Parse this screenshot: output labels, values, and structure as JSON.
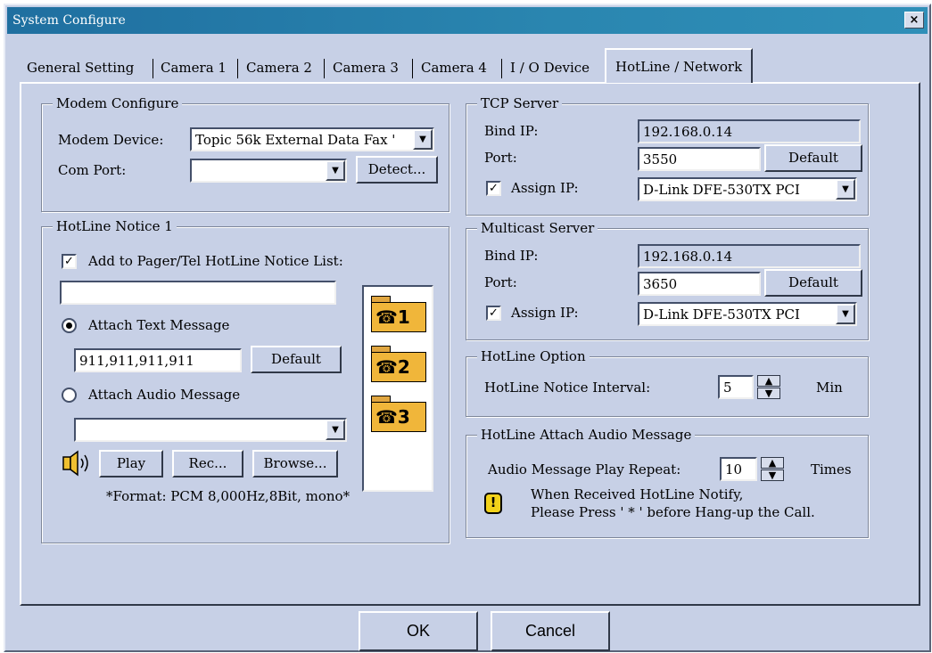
{
  "window": {
    "title": "System Configure",
    "close_glyph": "×"
  },
  "tabs": [
    {
      "label": "General Setting"
    },
    {
      "label": "Camera 1"
    },
    {
      "label": "Camera 2"
    },
    {
      "label": "Camera 3"
    },
    {
      "label": "Camera 4"
    },
    {
      "label": "I / O Device"
    },
    {
      "label": "HotLine / Network",
      "active": true
    }
  ],
  "modem": {
    "title": "Modem Configure",
    "device_label": "Modem Device:",
    "device_value": "Topic 56k External Data Fax '",
    "com_port_label": "Com Port:",
    "com_port_value": "",
    "detect_button": "Detect..."
  },
  "hotline_notice": {
    "title": "HotLine Notice 1",
    "add_checkbox_label": "Add to Pager/Tel HotLine Notice List:",
    "add_checked": true,
    "number_value": "",
    "attach_text_label": "Attach Text Message",
    "attach_text_selected": true,
    "text_message_value": "911,911,911,911",
    "default_button": "Default",
    "attach_audio_label": "Attach Audio Message",
    "audio_value": "",
    "play_button": "Play",
    "rec_button": "Rec...",
    "browse_button": "Browse...",
    "format_note": "*Format: PCM 8,000Hz,8Bit, mono*",
    "hotlines": [
      {
        "label": "1"
      },
      {
        "label": "2"
      },
      {
        "label": "3"
      }
    ]
  },
  "tcp_server": {
    "title": "TCP Server",
    "bind_ip_label": "Bind IP:",
    "bind_ip_value": "192.168.0.14",
    "port_label": "Port:",
    "port_value": "3550",
    "default_button": "Default",
    "assign_ip_label": "Assign IP:",
    "assign_checked": true,
    "adapter_value": "D-Link DFE-530TX PCI"
  },
  "multicast_server": {
    "title": "Multicast Server",
    "bind_ip_label": "Bind IP:",
    "bind_ip_value": "192.168.0.14",
    "port_label": "Port:",
    "port_value": "3650",
    "default_button": "Default",
    "assign_ip_label": "Assign IP:",
    "assign_checked": true,
    "adapter_value": "D-Link DFE-530TX PCI"
  },
  "hotline_option": {
    "title": "HotLine Option",
    "interval_label": "HotLine Notice Interval:",
    "interval_value": "5",
    "unit": "Min"
  },
  "audio_option": {
    "title": "HotLine Attach Audio Message",
    "repeat_label": "Audio Message Play Repeat:",
    "repeat_value": "10",
    "unit": "Times",
    "warning_line1": "When Received HotLine Notify,",
    "warning_line2": "Please Press ' * ' before Hang-up the Call."
  },
  "footer": {
    "ok": "OK",
    "cancel": "Cancel"
  },
  "glyphs": {
    "check": "✓",
    "drop": "▼",
    "up": "▲",
    "down": "▼",
    "phone": "☎",
    "warn": "!"
  },
  "colors": {
    "background": "#c7d0e6",
    "titlebar": "#1f6fa0",
    "folder": "#f0b63a",
    "warning": "#f2d21a"
  }
}
